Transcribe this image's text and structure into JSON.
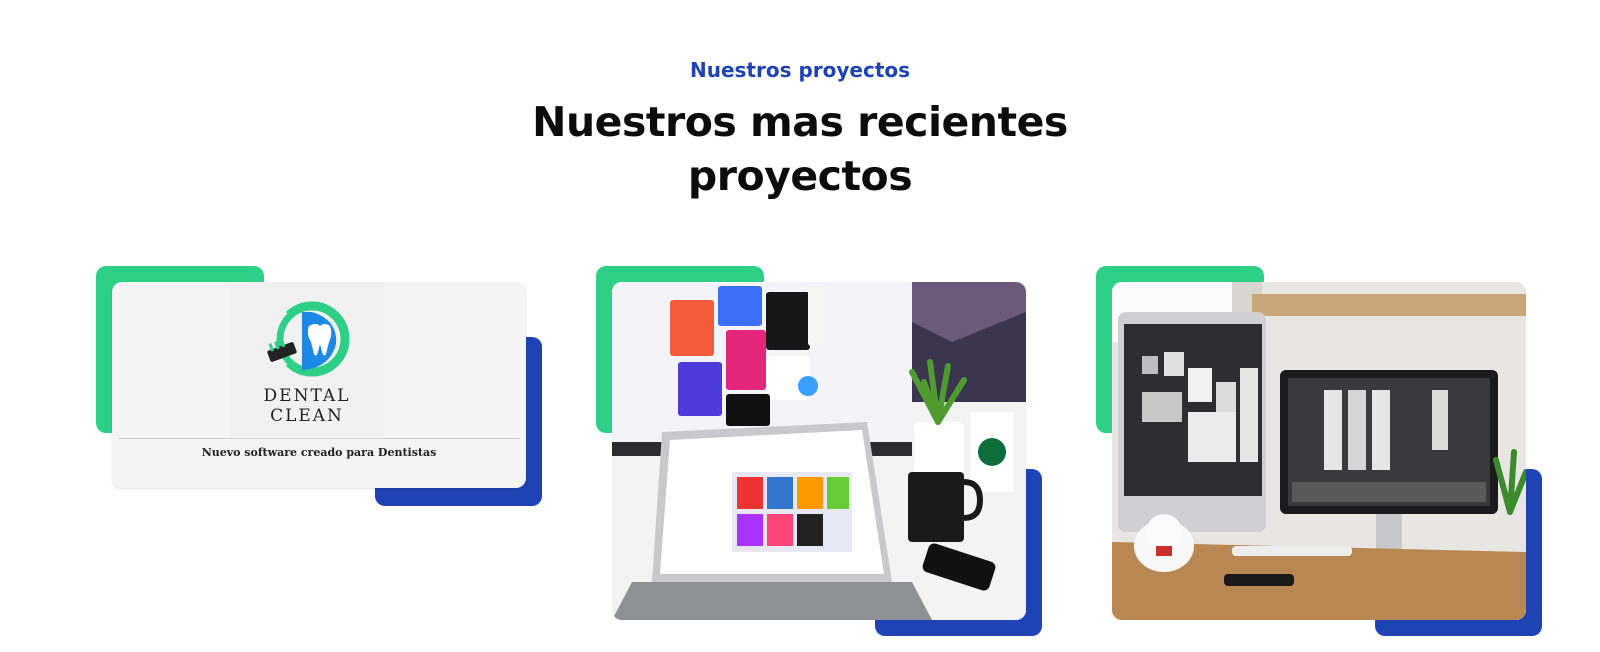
{
  "section": {
    "eyebrow": "Nuestros proyectos",
    "headline_line1": "Nuestros mas recientes",
    "headline_line2": "proyectos"
  },
  "projects": [
    {
      "logo_text": "DENTAL CLEAN",
      "caption": "Nuevo software creado para Dentistas"
    },
    {
      "photo": "laptop-design-workspace"
    },
    {
      "photo": "dual-monitor-desk"
    }
  ],
  "colors": {
    "accent_blue": "#1f42b4",
    "accent_green": "#2ecf87",
    "headline": "#0c0c0c"
  }
}
